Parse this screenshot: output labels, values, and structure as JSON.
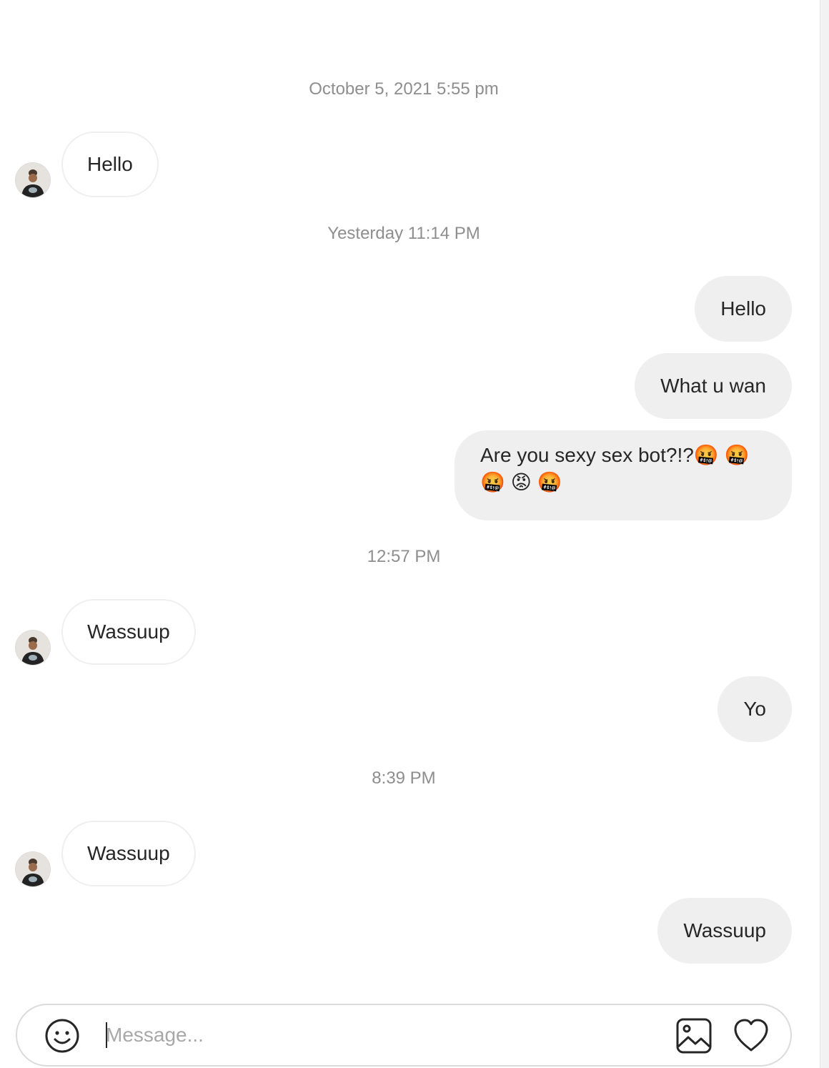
{
  "conversation": {
    "messages": [
      {
        "kind": "timestamp",
        "text": "October 5, 2021 5:55 pm"
      },
      {
        "kind": "incoming",
        "text": "Hello",
        "avatar": "contact-avatar"
      },
      {
        "kind": "timestamp",
        "text": "Yesterday 11:14 PM"
      },
      {
        "kind": "outgoing",
        "text": "Hello"
      },
      {
        "kind": "outgoing",
        "text": "What u wan"
      },
      {
        "kind": "outgoing",
        "text": "Are you sexy sex bot?!?🤬 🤬 🤬 😡 🤬"
      },
      {
        "kind": "timestamp",
        "text": "12:57 PM"
      },
      {
        "kind": "incoming",
        "text": "Wassuup",
        "avatar": "contact-avatar"
      },
      {
        "kind": "outgoing",
        "text": "Yo"
      },
      {
        "kind": "timestamp",
        "text": "8:39 PM"
      },
      {
        "kind": "incoming",
        "text": "Wassuup",
        "avatar": "contact-avatar"
      },
      {
        "kind": "outgoing",
        "text": "Wassuup"
      }
    ]
  },
  "composer": {
    "placeholder": "Message...",
    "value": "",
    "icons": {
      "emoji": "emoji-smile-icon",
      "image": "image-upload-icon",
      "like": "heart-icon"
    }
  },
  "colors": {
    "incoming_bubble_bg": "#ffffff",
    "outgoing_bubble_bg": "#efefef",
    "timestamp_text": "#8e8e8e",
    "message_text": "#262626",
    "placeholder_text": "#a8a8a8"
  }
}
